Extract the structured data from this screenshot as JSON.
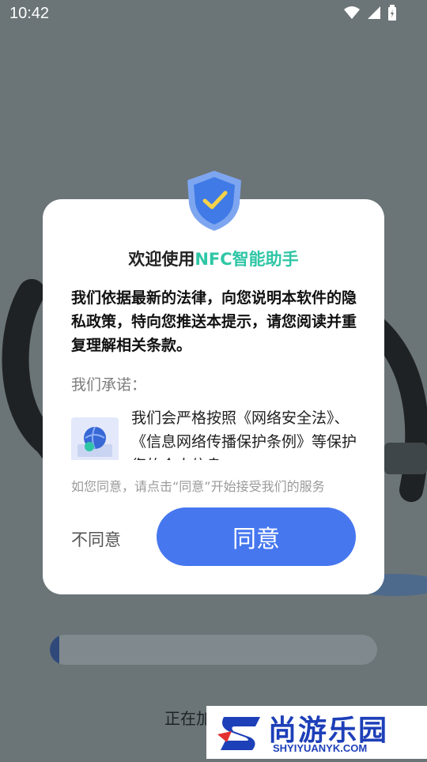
{
  "status": {
    "time": "10:42"
  },
  "dialog": {
    "title_prefix": "欢迎使用",
    "title_brand": "NFC智能助手",
    "lead": "我们依据最新的法律，向您说明本软件的隐私政策，特向您推送本提示，请您阅读并重复理解相关条款。",
    "promise_label": "我们承诺：",
    "promise_text": "我们会严格按照《网络安全法》、《信息网络传播保护条例》等保护您的个人信息",
    "consent_note": "如您同意，请点击“同意”开始接受我们的服务",
    "disagree_label": "不同意",
    "agree_label": "同意"
  },
  "loading": {
    "text": "正在加",
    "progress": 0.03
  },
  "watermark": {
    "cn": "尚游乐园",
    "en": "SHYIYUANYK.COM"
  },
  "icons": [
    "wifi-icon",
    "signal-icon",
    "battery-icon",
    "shield-check-icon",
    "globe-icon"
  ],
  "colors": {
    "accent": "#4677ef",
    "brand": "#2fc6a6"
  }
}
